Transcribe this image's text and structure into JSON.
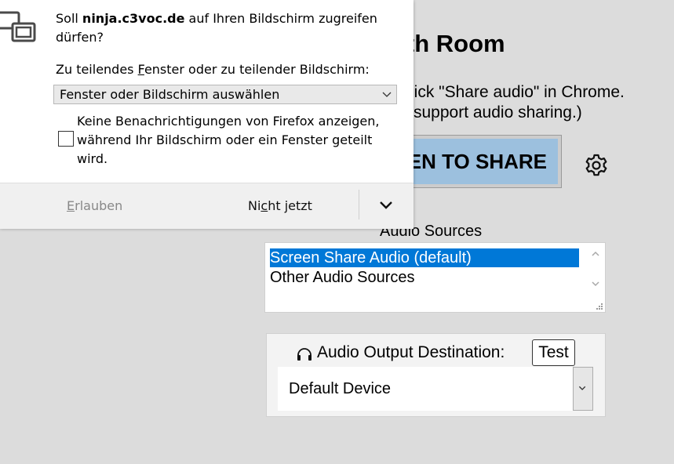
{
  "background": {
    "title": "are with Room",
    "line1": "lick \"Share audio\" in Chrome.",
    "line2": "support audio sharing.)",
    "share_button": "EN TO SHARE",
    "audio_sources_label": "Audio Sources",
    "audio_sources": [
      {
        "label": "Screen Share Audio (default)",
        "selected": true
      },
      {
        "label": "Other Audio Sources",
        "selected": false
      }
    ],
    "output_label": "Audio Output Destination:",
    "test_button": "Test",
    "output_device": "Default Device"
  },
  "popup": {
    "question_prefix": "Soll ",
    "site": "ninja.c3voc.de",
    "question_suffix": " auf Ihren Bildschirm zugreifen dürfen?",
    "field_label_a": "Zu teilendes ",
    "field_label_key": "F",
    "field_label_b": "enster oder zu teilender Bildschirm:",
    "select_value": "Fenster oder Bildschirm auswählen",
    "checkbox_label": "Keine Benachrichtigungen von Firefox anzeigen, während Ihr Bildschirm oder ein Fenster geteilt wird.",
    "allow_key": "E",
    "allow_rest": "rlauben",
    "notnow_a": "Ni",
    "notnow_key": "c",
    "notnow_b": "ht jetzt"
  },
  "colors": {
    "selection": "#0078d7",
    "share_button": "#9cc0de",
    "page_background": "#dcdcdc"
  }
}
